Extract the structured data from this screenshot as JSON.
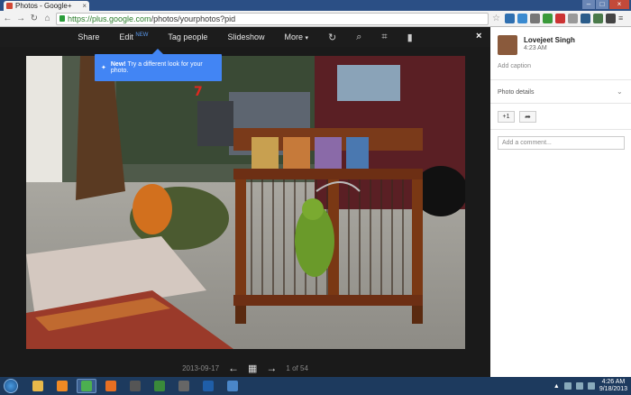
{
  "browser": {
    "tab_title": "Photos - Google+",
    "tab_close": "×",
    "url_domain": "https://plus.google.com",
    "url_path": "/photos/yourphotos?pid",
    "window_buttons": [
      "–",
      "□",
      "×"
    ]
  },
  "viewer_toolbar": {
    "share": "Share",
    "edit": "Edit",
    "edit_badge": "NEW",
    "tag_people": "Tag people",
    "slideshow": "Slideshow",
    "more": "More",
    "close": "×"
  },
  "tooltip": {
    "bold": "New!",
    "text": "Try a different look for your photo."
  },
  "annotation": "7",
  "navigation": {
    "date": "2013-09-17",
    "position": "1 of 54"
  },
  "sidebar": {
    "user_name": "Lovejeet Singh",
    "time": "4:23 AM",
    "add_caption": "Add caption",
    "photo_details": "Photo details",
    "plus_one": "+1",
    "comment_placeholder": "Add a comment..."
  },
  "taskbar": {
    "time": "4:26 AM",
    "date": "9/18/2013",
    "apps": [
      {
        "name": "explorer",
        "color": "#e8b94a"
      },
      {
        "name": "media-player",
        "color": "#f08a24"
      },
      {
        "name": "chrome",
        "color": "#4caf50",
        "active": true
      },
      {
        "name": "firefox",
        "color": "#e76f22"
      },
      {
        "name": "game",
        "color": "#555555"
      },
      {
        "name": "app-star",
        "color": "#3a8a3a"
      },
      {
        "name": "app-pen",
        "color": "#666666"
      },
      {
        "name": "photoshop",
        "color": "#1f5ea8"
      },
      {
        "name": "app-blue",
        "color": "#4a86c8"
      }
    ]
  }
}
